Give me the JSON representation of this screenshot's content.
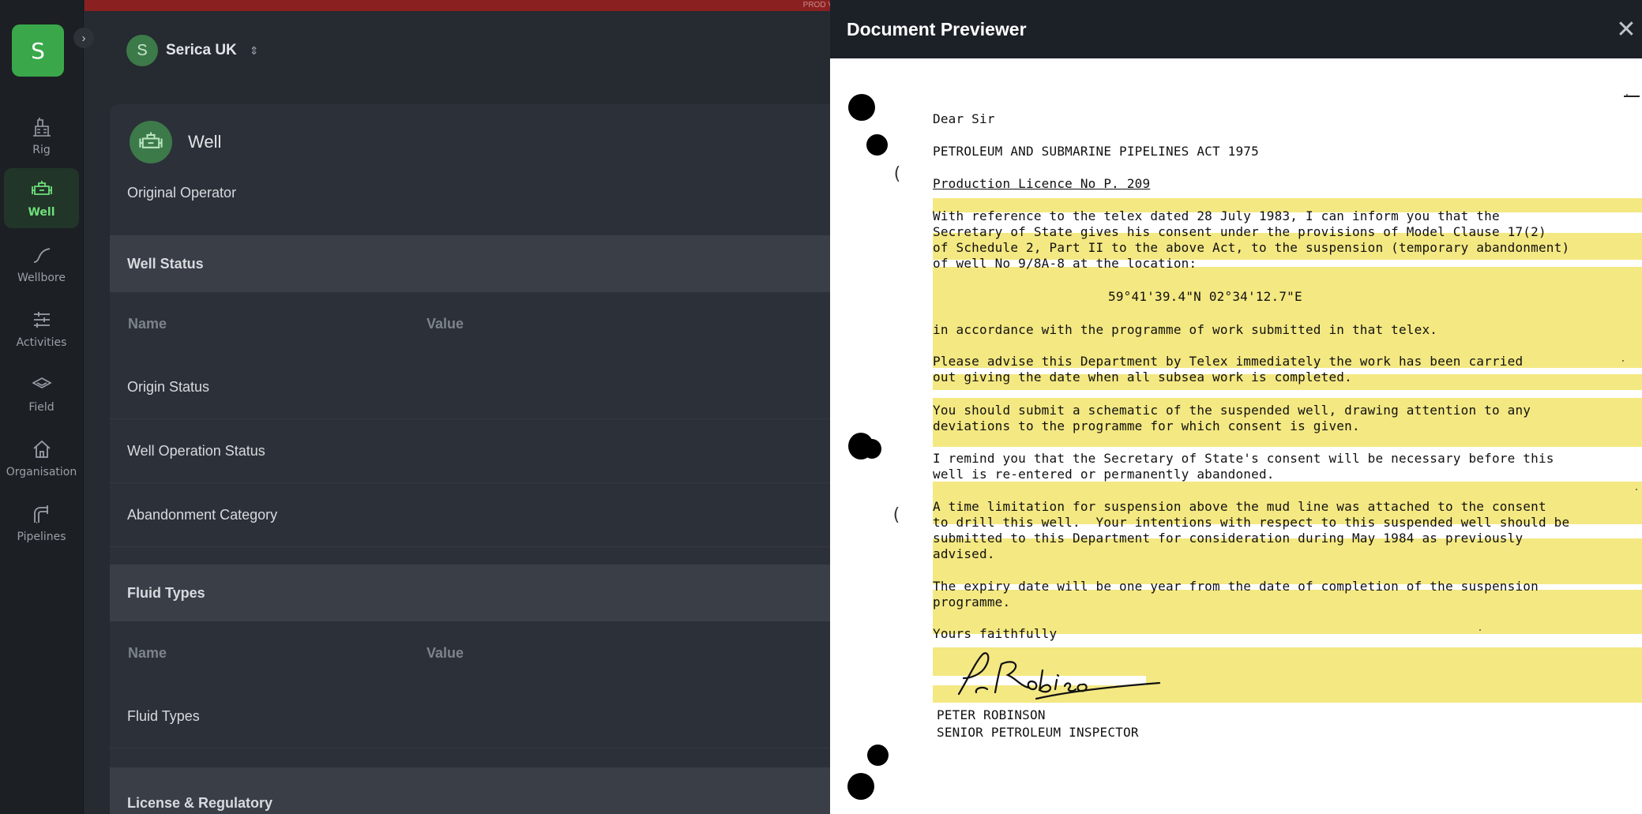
{
  "env_banner": "PROD V",
  "org": {
    "initial": "S",
    "name": "Serica UK",
    "caret": "⌃"
  },
  "brand_initial": "S",
  "nav": [
    {
      "label": "Rig"
    },
    {
      "label": "Well"
    },
    {
      "label": "Wellbore"
    },
    {
      "label": "Activities"
    },
    {
      "label": "Field"
    },
    {
      "label": "Organisation"
    },
    {
      "label": "Pipelines"
    }
  ],
  "panel": {
    "title": "Well",
    "original_operator_label": "Original Operator",
    "well_status": {
      "heading": "Well Status",
      "col_name": "Name",
      "col_value": "Value",
      "rows": [
        "Origin Status",
        "Well Operation Status",
        "Abandonment Category"
      ]
    },
    "fluid_types": {
      "heading": "Fluid Types",
      "col_name": "Name",
      "col_value": "Value",
      "rows": [
        "Fluid Types"
      ]
    },
    "license_heading": "License & Regulatory"
  },
  "previewer": {
    "title": "Document Previewer",
    "close": "✕",
    "letter": {
      "salutation": "Dear Sir",
      "act": "PETROLEUM AND SUBMARINE PIPELINES ACT 1975",
      "licence": "Production Licence No P. 209",
      "para1": [
        "With reference to the telex dated 28 July 1983, I can inform you that the",
        "Secretary of State gives his consent under the provisions of Model Clause 17(2)",
        "of Schedule 2, Part II to the above Act, to the suspension (temporary abandonment)",
        "of well No 9/8A-8 at the location:"
      ],
      "location": "59°41'39.4\"N 02°34'12.7\"E",
      "para2": "in accordance with the programme of work submitted in that telex.",
      "para3": [
        "Please advise this Department by Telex immediately the work has been carried",
        "out giving the date when all subsea work is completed."
      ],
      "para4": [
        "You should submit a schematic of the suspended well, drawing attention to any",
        "deviations to the programme for which consent is given."
      ],
      "para5": [
        "I remind you that the Secretary of State's consent will be necessary before this",
        "well is re-entered or permanently abandoned."
      ],
      "para6": [
        "A time limitation for suspension above the mud line was attached to the consent",
        "to drill this well.  Your intentions with respect to this suspended well should be",
        "submitted to this Department for consideration during May 1984 as previously",
        "advised."
      ],
      "para7": [
        "The expiry date will be one year from the date of completion of the suspension",
        "programme."
      ],
      "closing": "Yours faithfully",
      "signatory_name": "PETER ROBINSON",
      "signatory_title": "SENIOR PETROLEUM INSPECTOR",
      "signature_text": "P. Robinson"
    }
  }
}
